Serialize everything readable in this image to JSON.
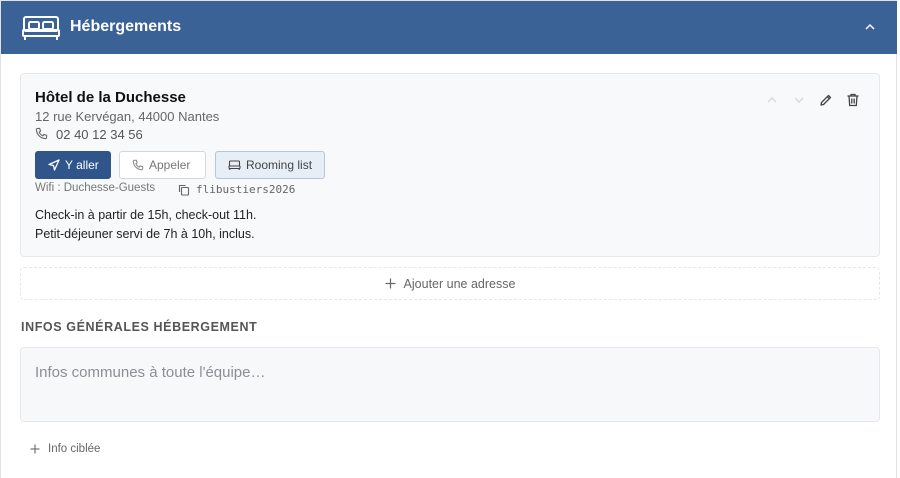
{
  "header": {
    "title": "Hébergements",
    "icon": "bed-icon",
    "color": "#3b6296"
  },
  "hotel": {
    "name": "Hôtel de la Duchesse",
    "address": "12 rue Kervégan, 44000 Nantes",
    "phone": "02 40 12 34 56",
    "buttons": {
      "go": "Y aller",
      "call": "Appeler",
      "rooming": "Rooming list"
    },
    "wifi_label": "Wifi : Duchesse-Guests",
    "wifi_password": "flibustiers2026",
    "notes": [
      "Check-in à partir de 15h, check-out 11h.",
      "Petit-déjeuner servi de 7h à 10h, inclus."
    ]
  },
  "add_address": "Ajouter une adresse",
  "general_section": {
    "title": "INFOS GÉNÉRALES HÉBERGEMENT",
    "placeholder": "Infos communes à toute l'équipe…"
  },
  "targeted_info": "Info ciblée"
}
